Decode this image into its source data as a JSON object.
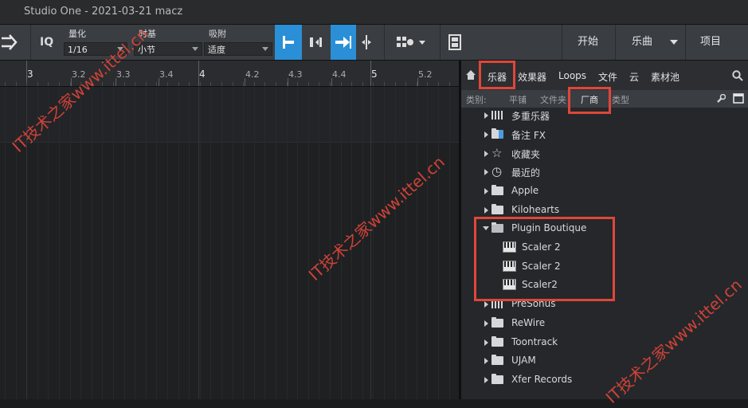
{
  "window": {
    "title": "Studio One - 2021-03-21 macz"
  },
  "toolbar": {
    "iq_label": "IQ",
    "quantize": {
      "label": "量化",
      "value": "1/16"
    },
    "timebase": {
      "label": "时基",
      "value": "小节"
    },
    "snap": {
      "label": "吸附",
      "value": "适度"
    },
    "start_label": "开始",
    "song_label": "乐曲",
    "project_label": "项目"
  },
  "ruler": {
    "labels": [
      "3",
      "3.2",
      "3.3",
      "3.4",
      "4",
      "4.2",
      "4.3",
      "4.4",
      "5",
      "5.2"
    ],
    "major": [
      "3",
      "4",
      "5"
    ]
  },
  "browser": {
    "tabs": [
      "乐器",
      "效果器",
      "Loops",
      "文件",
      "云",
      "素材池"
    ],
    "sort_label": "类别:",
    "sort_options": [
      "平铺",
      "文件夹",
      "厂商",
      "类型"
    ],
    "active_sort": "厂商",
    "items": [
      {
        "label": "多重乐器",
        "icon": "multi-instrument-icon",
        "open": false,
        "indent": 0
      },
      {
        "label": "备注 FX",
        "icon": "fx-folder-icon",
        "open": false,
        "indent": 0
      },
      {
        "label": "收藏夹",
        "icon": "star-icon",
        "open": false,
        "indent": 0
      },
      {
        "label": "最近的",
        "icon": "clock-icon",
        "open": false,
        "indent": 0
      },
      {
        "label": "Apple",
        "icon": "folder-icon",
        "open": false,
        "indent": 0
      },
      {
        "label": "Kilohearts",
        "icon": "folder-icon",
        "open": false,
        "indent": 0
      },
      {
        "label": "Plugin Boutique",
        "icon": "folder-open-icon",
        "open": true,
        "indent": 0
      },
      {
        "label": "Scaler 2",
        "icon": "piano-icon",
        "open": null,
        "indent": 1
      },
      {
        "label": "Scaler 2",
        "icon": "piano-icon",
        "open": null,
        "indent": 1
      },
      {
        "label": "Scaler2",
        "icon": "piano-icon",
        "open": null,
        "indent": 1
      },
      {
        "label": "PreSonus",
        "icon": "presonus-icon",
        "open": false,
        "indent": 0
      },
      {
        "label": "ReWire",
        "icon": "folder-icon",
        "open": false,
        "indent": 0
      },
      {
        "label": "Toontrack",
        "icon": "folder-icon",
        "open": false,
        "indent": 0
      },
      {
        "label": "UJAM",
        "icon": "folder-icon",
        "open": false,
        "indent": 0
      },
      {
        "label": "Xfer Records",
        "icon": "folder-icon",
        "open": false,
        "indent": 0
      }
    ]
  },
  "watermark": {
    "text": "IT技术之家www.ittel.cn"
  },
  "colors": {
    "accent": "#2a8fd6",
    "highlight": "#e0463a"
  }
}
